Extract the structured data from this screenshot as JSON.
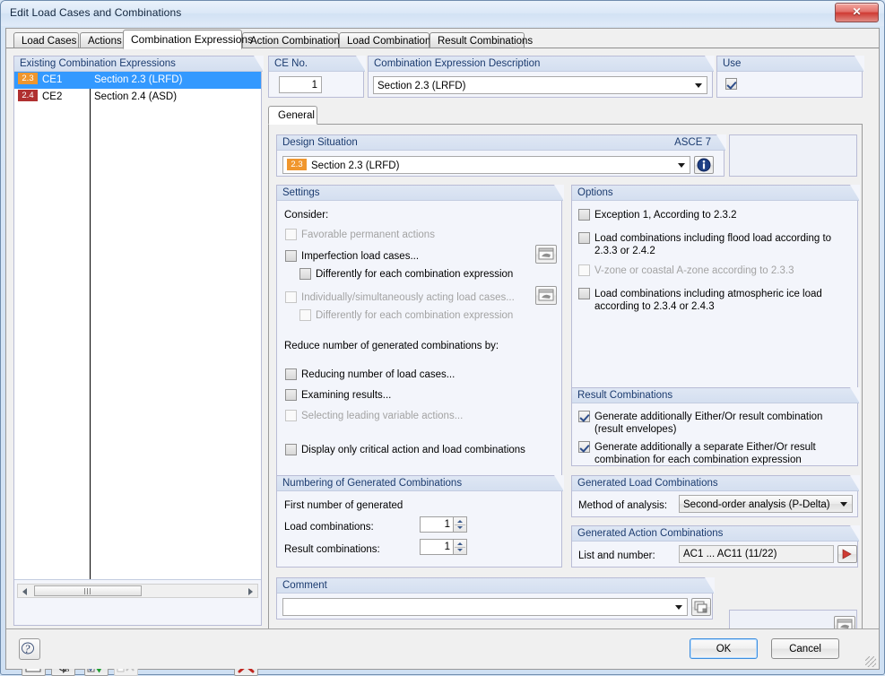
{
  "window": {
    "title": "Edit Load Cases and Combinations",
    "close_label": "✕"
  },
  "tabs": [
    {
      "label": "Load Cases",
      "active": false
    },
    {
      "label": "Actions",
      "active": false
    },
    {
      "label": "Combination Expressions",
      "active": true
    },
    {
      "label": "Action Combinations",
      "active": false
    },
    {
      "label": "Load Combinations",
      "active": false
    },
    {
      "label": "Result Combinations",
      "active": false
    }
  ],
  "existing": {
    "title": "Existing Combination Expressions",
    "rows": [
      {
        "tag": "2.3",
        "name": "CE1",
        "description": "Section 2.3 (LRFD)",
        "selected": true
      },
      {
        "tag": "2.4",
        "name": "CE2",
        "description": "Section 2.4 (ASD)",
        "selected": false
      }
    ]
  },
  "ce_no": {
    "title": "CE No.",
    "value": "1"
  },
  "description": {
    "title": "Combination Expression Description",
    "value": "Section 2.3 (LRFD)"
  },
  "use": {
    "title": "Use",
    "checked": true
  },
  "subtab": {
    "label": "General"
  },
  "design_situation": {
    "title": "Design Situation",
    "standard": "ASCE 7",
    "tag": "2.3",
    "value": "Section 2.3 (LRFD)",
    "info_icon": "info-icon"
  },
  "settings": {
    "title": "Settings",
    "consider_label": "Consider:",
    "items": [
      {
        "label": "Favorable permanent actions",
        "checked": false,
        "disabled": true,
        "indent": 0,
        "icon_button": false
      },
      {
        "label": "Imperfection load cases...",
        "checked": false,
        "disabled": false,
        "indent": 0,
        "icon_button": true
      },
      {
        "label": "Differently for each combination expression",
        "checked": false,
        "disabled": false,
        "indent": 1,
        "icon_button": false
      },
      {
        "label": "Individually/simultaneously acting load cases...",
        "checked": false,
        "disabled": true,
        "indent": 0,
        "icon_button": true
      },
      {
        "label": "Differently for each combination expression",
        "checked": false,
        "disabled": true,
        "indent": 1,
        "icon_button": false
      }
    ],
    "reduce_label": "Reduce number of generated combinations by:",
    "reduce_items": [
      {
        "label": "Reducing number of load cases...",
        "checked": false,
        "disabled": false
      },
      {
        "label": "Examining results...",
        "checked": false,
        "disabled": false
      },
      {
        "label": "Selecting leading variable actions...",
        "checked": false,
        "disabled": true
      }
    ],
    "display_item": {
      "label": "Display only critical action and load combinations",
      "checked": false,
      "disabled": false
    }
  },
  "options": {
    "title": "Options",
    "items": [
      {
        "label": "Exception 1, According to 2.3.2",
        "checked": false,
        "disabled": false
      },
      {
        "label": "Load combinations including flood load according to 2.3.3 or 2.4.2",
        "checked": false,
        "disabled": false
      },
      {
        "label": "V-zone or coastal A-zone according to 2.3.3",
        "checked": false,
        "disabled": true
      },
      {
        "label": "Load combinations including atmospheric ice load according to 2.3.4 or 2.4.3",
        "checked": false,
        "disabled": false
      }
    ]
  },
  "result_combinations": {
    "title": "Result Combinations",
    "items": [
      {
        "label": "Generate additionally Either/Or result combination (result envelopes)",
        "checked": true
      },
      {
        "label": "Generate additionally a separate Either/Or result combination for each combination expression",
        "checked": true
      }
    ]
  },
  "numbering": {
    "title": "Numbering of Generated Combinations",
    "first_label": "First number of generated",
    "load_label": "Load combinations:",
    "load_value": "1",
    "result_label": "Result combinations:",
    "result_value": "1"
  },
  "generated_load": {
    "title": "Generated Load Combinations",
    "method_label": "Method of analysis:",
    "method_value": "Second-order analysis (P-Delta)"
  },
  "generated_action": {
    "title": "Generated Action Combinations",
    "list_label": "List and number:",
    "list_value": "AC1 ... AC11 (11/22)",
    "go_icon": "play-arrow-icon"
  },
  "comment": {
    "title": "Comment",
    "value": ""
  },
  "list_toolbar": [
    {
      "name": "new-combination-expression-button",
      "icon": "new-window-icon",
      "disabled": false
    },
    {
      "name": "rename-button",
      "icon": "rename-ab-icon",
      "disabled": false
    },
    {
      "name": "select-all-button",
      "icon": "check-all-icon",
      "disabled": false
    },
    {
      "name": "deselect-all-button",
      "icon": "uncheck-all-icon",
      "disabled": true
    },
    {
      "name": "delete-button",
      "icon": "red-x-icon",
      "disabled": false
    }
  ],
  "footer": {
    "help_icon": "question-mark-icon",
    "ok_label": "OK",
    "cancel_label": "Cancel"
  },
  "colors": {
    "accent_selection": "#3399ff",
    "group_header_text": "#1b3b6f",
    "tag_lrfd": "#f0962d",
    "tag_asd": "#b03030",
    "close_red": "#cf3a33"
  }
}
